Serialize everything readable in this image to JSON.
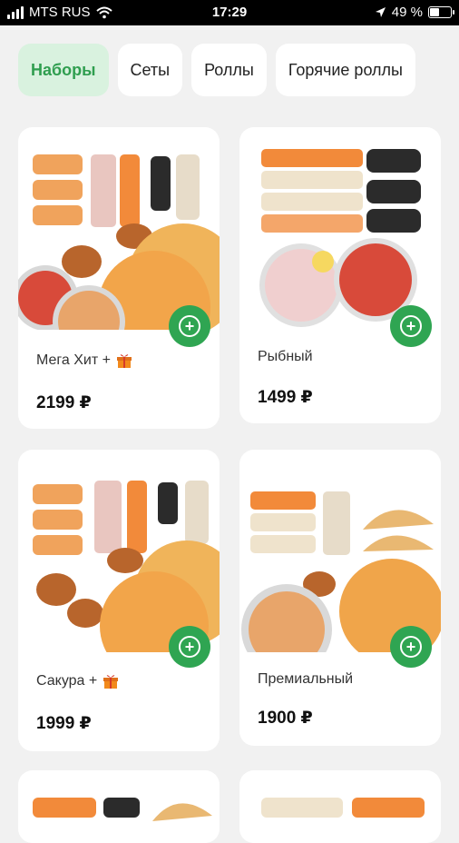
{
  "status_bar": {
    "carrier": "MTS RUS",
    "time": "17:29",
    "battery": "49 %",
    "battery_level": 0.49
  },
  "tabs": [
    {
      "label": "Наборы",
      "active": true
    },
    {
      "label": "Сеты"
    },
    {
      "label": "Роллы"
    },
    {
      "label": "Горячие роллы"
    }
  ],
  "products": [
    {
      "name": "Мега Хит +",
      "price": "2199 ₽",
      "gift": true
    },
    {
      "name": "Рыбный",
      "price": "1499 ₽",
      "gift": false
    },
    {
      "name": "Сакура +",
      "price": "1999 ₽",
      "gift": true
    },
    {
      "name": "Премиальный",
      "price": "1900 ₽",
      "gift": false
    }
  ],
  "colors": {
    "accent": "#2fa552",
    "active_tab_bg": "#d9f2df",
    "active_tab_text": "#2f9e4f"
  }
}
